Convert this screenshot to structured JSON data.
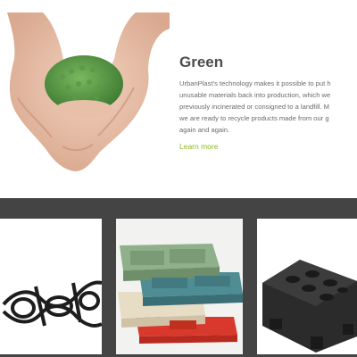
{
  "hero": {
    "image_alt": "hands-holding-green-pellets",
    "title": "Green",
    "body_lines": [
      "UrbanPlast’s technology makes it possible to put h",
      "unusable materials back into production, which we",
      "previously incinerated or consigned to a landfill. M",
      "we are ready to recycle products made from our g",
      "again and again."
    ],
    "link_label": "Learn more"
  },
  "products": [
    {
      "icon": "black-plastic-grid-image"
    },
    {
      "icon": "stacked-colored-trays-image"
    },
    {
      "icon": "black-plastic-pallet-image"
    }
  ],
  "colors": {
    "heading": "#4d4d4d",
    "body_text": "#6b6b6b",
    "link": "#8dbb1f",
    "band": "#444444"
  }
}
